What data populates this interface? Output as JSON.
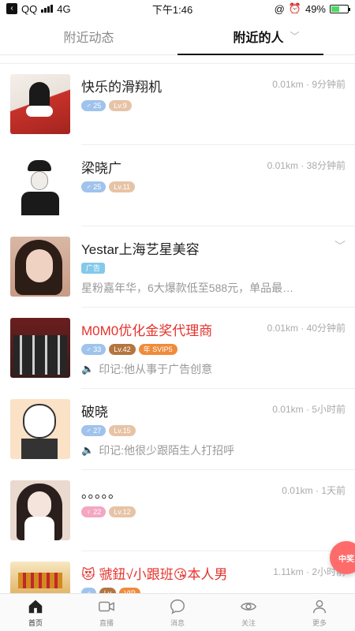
{
  "status": {
    "carrier": "QQ",
    "network": "4G",
    "time": "下午1:46",
    "battery": "49%",
    "battery_level": 0.49
  },
  "tabs": [
    {
      "label": "附近动态",
      "active": false
    },
    {
      "label": "附近的人",
      "active": true
    }
  ],
  "items": [
    {
      "name": "快乐的滑翔机",
      "meta": "0.01km · 9分钟前",
      "gender": "♂",
      "age": "25",
      "level": "Lv.9",
      "avatar_colors": [
        "#f3efe9",
        "#c7322a"
      ]
    },
    {
      "name": "梁晓广",
      "meta": "0.01km · 38分钟前",
      "gender": "♂",
      "age": "25",
      "level": "Lv.11",
      "avatar_colors": [
        "#ffffff",
        "#1a1a1a"
      ]
    },
    {
      "name": "Yestar上海艺星美容",
      "ad_label": "广告",
      "desc": "星粉嘉年华，6大爆款低至588元，单品最…",
      "avatar_colors": [
        "#c79b85",
        "#2c1d17"
      ]
    },
    {
      "name": "M0M0优化金奖代理商",
      "meta": "0.01km · 40分钟前",
      "gender": "♂",
      "age": "33",
      "level": "Lv.42",
      "vip": "年",
      "svip": "SVIP5",
      "note": "印记:他从事于广告创意",
      "avatar_colors": [
        "#6b1e1e",
        "#262626"
      ]
    },
    {
      "name": "破晓",
      "meta": "0.01km · 5小时前",
      "gender": "♂",
      "age": "27",
      "level": "Lv.15",
      "note": "印记:他很少跟陌生人打招呼",
      "avatar_colors": [
        "#fbe1c6",
        "#333333"
      ]
    },
    {
      "name": "。。。。。",
      "meta": "0.01km · 1天前",
      "gender": "♀",
      "age": "22",
      "level": "Lv.12",
      "avatar_colors": [
        "#ead9cf",
        "#2a1f1c"
      ]
    },
    {
      "name": "😻 虢鈕√小跟班😘本人男",
      "meta": "1.11km · 2小时前",
      "gender": "♂",
      "age": "",
      "level": "",
      "avatar_colors": [
        "#f6e7c1",
        "#d18a1d"
      ]
    }
  ],
  "float_button": {
    "label": "中奖"
  },
  "tabbar": [
    {
      "label": "首页",
      "icon": "home-icon",
      "active": true
    },
    {
      "label": "直播",
      "icon": "video-icon",
      "active": false
    },
    {
      "label": "消息",
      "icon": "message-icon",
      "active": false
    },
    {
      "label": "关注",
      "icon": "eye-icon",
      "active": false
    },
    {
      "label": "更多",
      "icon": "person-icon",
      "active": false
    }
  ]
}
